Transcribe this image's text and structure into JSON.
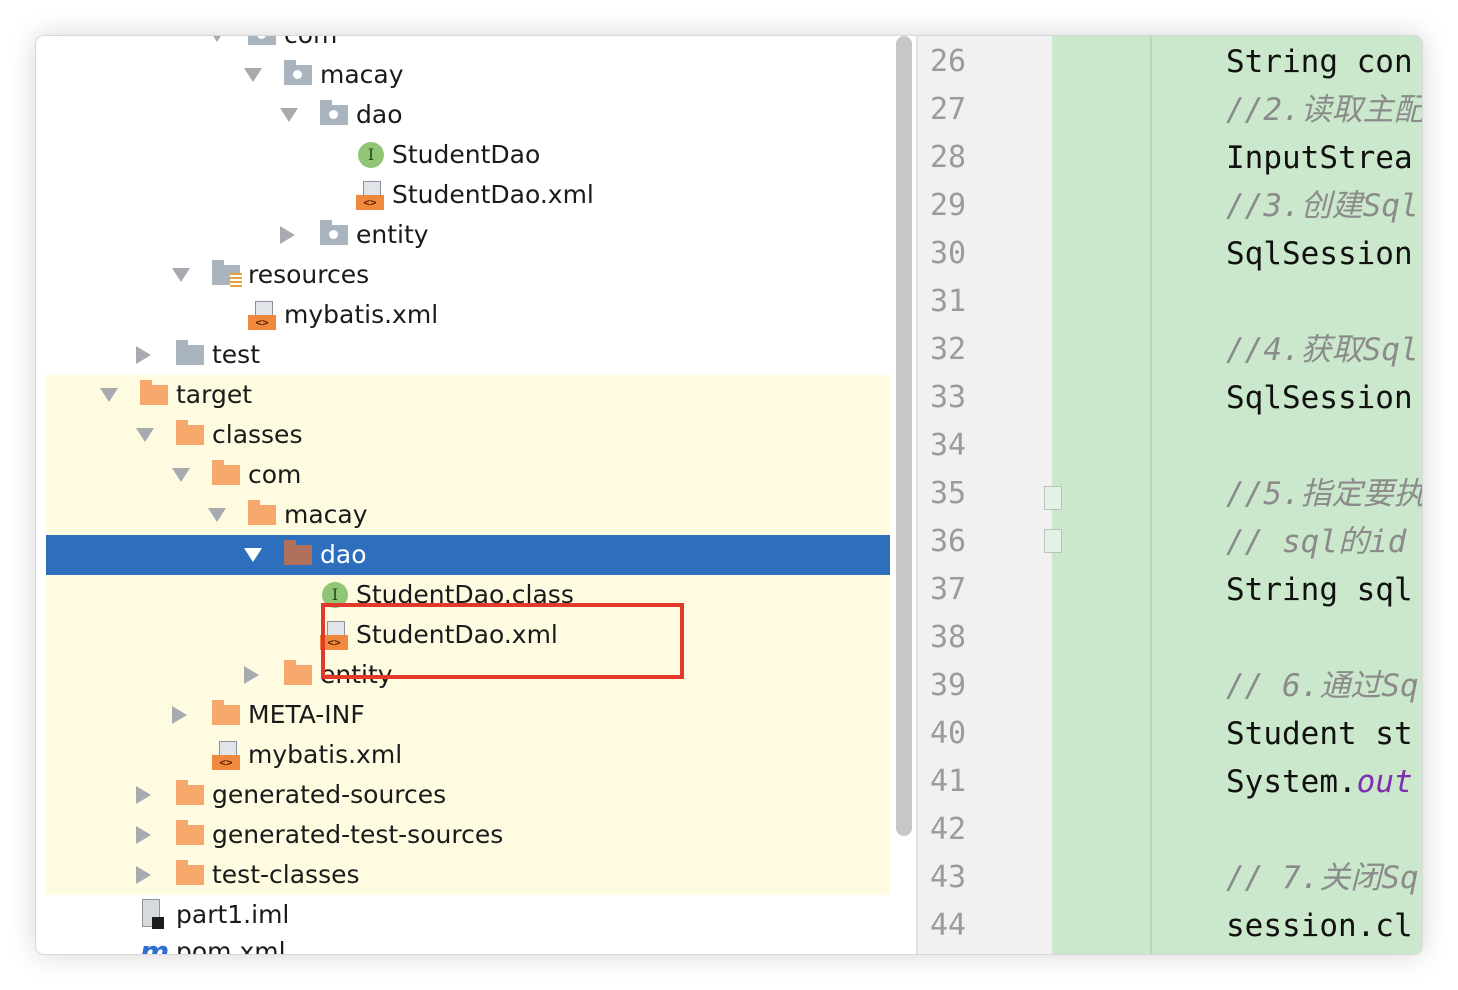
{
  "tree": {
    "items": [
      {
        "label": "com",
        "icon": "package-folder-icon",
        "arrow": "down"
      },
      {
        "label": "macay",
        "icon": "package-folder-icon",
        "arrow": "down"
      },
      {
        "label": "dao",
        "icon": "package-folder-icon",
        "arrow": "down"
      },
      {
        "label": "StudentDao",
        "icon": "interface-icon",
        "arrow": "none"
      },
      {
        "label": "StudentDao.xml",
        "icon": "xml-file-icon",
        "arrow": "none"
      },
      {
        "label": "entity",
        "icon": "package-folder-icon",
        "arrow": "right"
      },
      {
        "label": "resources",
        "icon": "resources-folder-icon",
        "arrow": "down"
      },
      {
        "label": "mybatis.xml",
        "icon": "xml-file-icon",
        "arrow": "none"
      },
      {
        "label": "test",
        "icon": "folder-icon",
        "arrow": "right"
      },
      {
        "label": "target",
        "icon": "excluded-folder-icon",
        "arrow": "down"
      },
      {
        "label": "classes",
        "icon": "excluded-folder-icon",
        "arrow": "down"
      },
      {
        "label": "com",
        "icon": "excluded-folder-icon",
        "arrow": "down"
      },
      {
        "label": "macay",
        "icon": "excluded-folder-icon",
        "arrow": "down"
      },
      {
        "label": "dao",
        "icon": "excluded-folder-icon",
        "arrow": "down",
        "selected": true
      },
      {
        "label": "StudentDao.class",
        "icon": "interface-icon",
        "arrow": "none"
      },
      {
        "label": "StudentDao.xml",
        "icon": "xml-file-icon",
        "arrow": "none"
      },
      {
        "label": "entity",
        "icon": "excluded-folder-icon",
        "arrow": "right"
      },
      {
        "label": "META-INF",
        "icon": "excluded-folder-icon",
        "arrow": "right"
      },
      {
        "label": "mybatis.xml",
        "icon": "xml-file-icon",
        "arrow": "none"
      },
      {
        "label": "generated-sources",
        "icon": "excluded-folder-icon",
        "arrow": "right"
      },
      {
        "label": "generated-test-sources",
        "icon": "excluded-folder-icon",
        "arrow": "right"
      },
      {
        "label": "test-classes",
        "icon": "excluded-folder-icon",
        "arrow": "right"
      },
      {
        "label": "part1.iml",
        "icon": "iml-file-icon",
        "arrow": "none"
      },
      {
        "label": "pom.xml",
        "icon": "maven-pom-icon",
        "arrow": "none"
      }
    ],
    "iface_letter": "I",
    "xml_tag": "<>",
    "pom_letter": "m"
  },
  "editor": {
    "line_numbers": [
      "26",
      "27",
      "28",
      "29",
      "30",
      "31",
      "32",
      "33",
      "34",
      "35",
      "36",
      "37",
      "38",
      "39",
      "40",
      "41",
      "42",
      "43",
      "44"
    ],
    "lines": [
      {
        "text": "String con",
        "type": "code"
      },
      {
        "text": "//2.读取主配",
        "type": "comment"
      },
      {
        "text": "InputStrea",
        "type": "code"
      },
      {
        "text": "//3.创建Sql",
        "type": "comment"
      },
      {
        "text": "SqlSession",
        "type": "code"
      },
      {
        "text": "",
        "type": "code"
      },
      {
        "text": "//4.获取Sql",
        "type": "comment"
      },
      {
        "text": "SqlSession",
        "type": "code"
      },
      {
        "text": "",
        "type": "code"
      },
      {
        "text": "//5.指定要执",
        "type": "comment"
      },
      {
        "text": "//  sql的id",
        "type": "comment"
      },
      {
        "text": "String sql",
        "type": "code"
      },
      {
        "text": "",
        "type": "code"
      },
      {
        "text": "// 6.通过Sq",
        "type": "comment"
      },
      {
        "text": "Student st",
        "type": "code"
      },
      {
        "text": "System.",
        "type": "code",
        "suffix": "out"
      },
      {
        "text": "",
        "type": "code"
      },
      {
        "text": "// 7.关闭Sq",
        "type": "comment"
      },
      {
        "text": "session.cl",
        "type": "code"
      }
    ]
  },
  "colors": {
    "selection": "#2e6fbd",
    "target_tint": "#fefbe1",
    "highlight_box": "#e13a2b",
    "editor_green": "#cbe7cc"
  }
}
